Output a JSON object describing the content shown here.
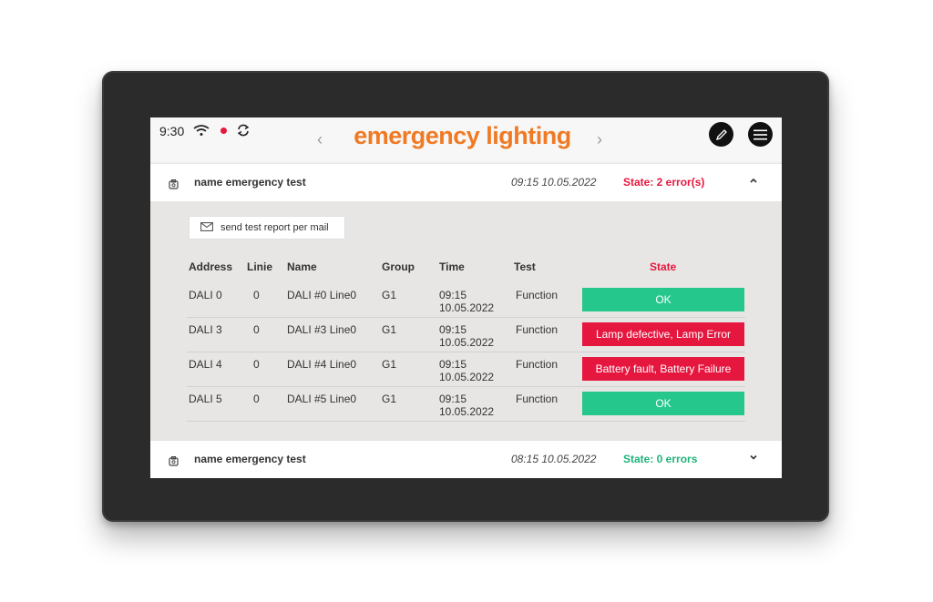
{
  "header": {
    "time": "9:30",
    "title": "emergency lighting"
  },
  "sections": [
    {
      "name": "name emergency test",
      "time": "09:15  10.05.2022",
      "state": "State: 2 error(s)",
      "state_color": "#e5173f",
      "chevron": "up"
    },
    {
      "name": "name emergency test",
      "time": "08:15 10.05.2022",
      "state": "State: 0 errors",
      "state_color": "#20b37a",
      "chevron": "down"
    }
  ],
  "panel": {
    "mail_button_label": "send test report per mail",
    "columns": [
      "Address",
      "Linie",
      "Name",
      "Group",
      "Time",
      "Test",
      "State"
    ],
    "rows": [
      {
        "address": "DALI 0",
        "linie": "0",
        "name": "DALI #0 Line0",
        "group": "G1",
        "time1": "09:15",
        "time2": "10.05.2022",
        "test": "Function",
        "state": "OK",
        "state_color": "#26c78d"
      },
      {
        "address": "DALI 3",
        "linie": "0",
        "name": "DALI #3 Line0",
        "group": "G1",
        "time1": "09:15",
        "time2": "10.05.2022",
        "test": "Function",
        "state": "Lamp defective, Lamp Error",
        "state_color": "#e5173f"
      },
      {
        "address": "DALI 4",
        "linie": "0",
        "name": "DALI #4 Line0",
        "group": "G1",
        "time1": "09:15",
        "time2": "10.05.2022",
        "test": "Function",
        "state": "Battery fault, Battery Failure",
        "state_color": "#e5173f"
      },
      {
        "address": "DALI 5",
        "linie": "0",
        "name": "DALI #5 Line0",
        "group": "G1",
        "time1": "09:15",
        "time2": "10.05.2022",
        "test": "Function",
        "state": "OK",
        "state_color": "#26c78d"
      }
    ]
  },
  "colors": {
    "accent": "#f07a24",
    "error": "#e5173f",
    "ok": "#26c78d"
  }
}
